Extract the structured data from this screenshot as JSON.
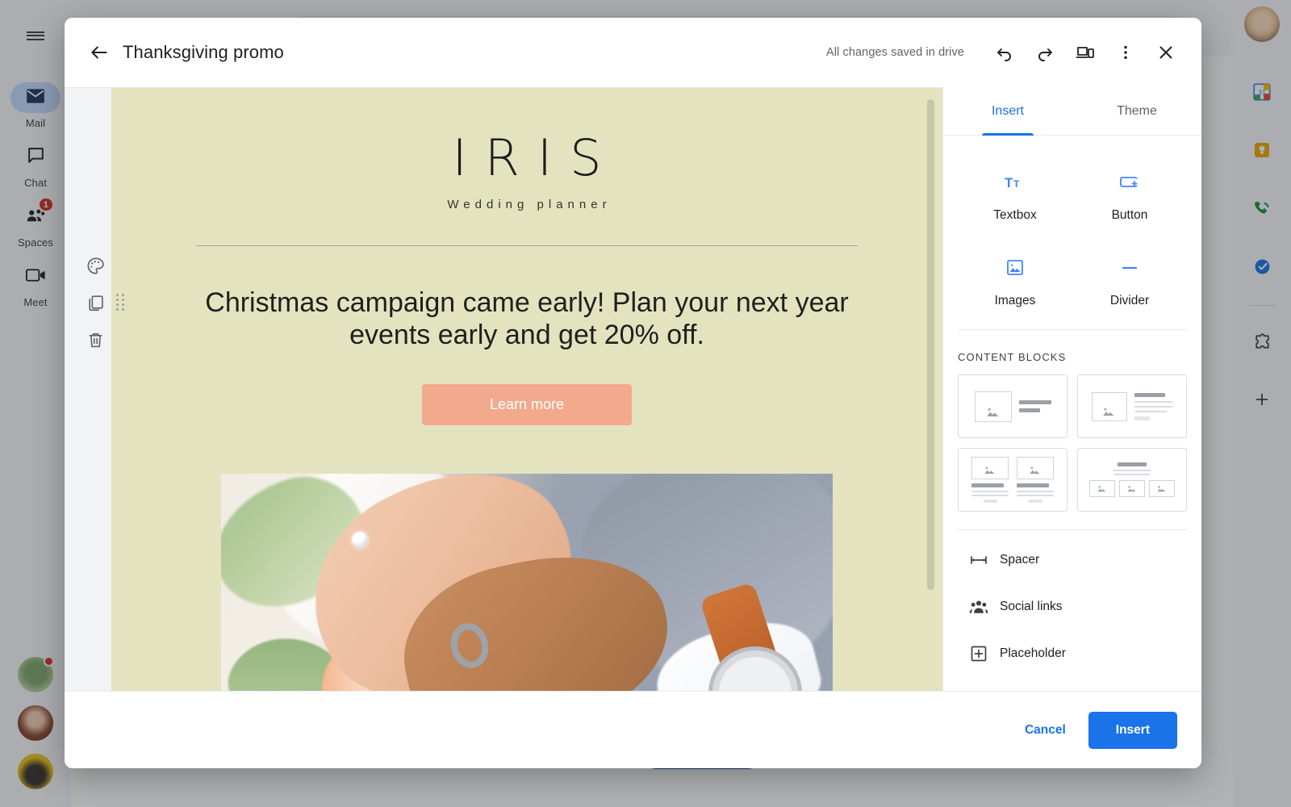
{
  "app": {
    "left_rail": {
      "menu_icon": "hamburger-menu-icon",
      "items": [
        {
          "label": "Mail",
          "icon": "mail-icon",
          "active": true,
          "badge": ""
        },
        {
          "label": "Chat",
          "icon": "chat-bubble-icon",
          "active": false,
          "badge": ""
        },
        {
          "label": "Spaces",
          "icon": "spaces-people-icon",
          "active": false,
          "badge": "1"
        },
        {
          "label": "Meet",
          "icon": "video-camera-icon",
          "active": false,
          "badge": ""
        }
      ]
    },
    "right_rail": {
      "icons": [
        "calendar-icon",
        "keep-notes-icon",
        "voice-phone-icon",
        "tasks-icon",
        "addons-puzzle-icon",
        "add-plus-icon"
      ]
    }
  },
  "modal": {
    "header": {
      "back_icon": "arrow-back-icon",
      "title": "Thanksgiving promo",
      "save_status": "All changes saved in drive",
      "undo_icon": "undo-icon",
      "redo_icon": "redo-icon",
      "preview_icon": "device-preview-icon",
      "more_icon": "more-vertical-icon",
      "close_icon": "close-icon"
    },
    "canvas": {
      "tools": [
        "palette-icon",
        "duplicate-icon",
        "trash-icon"
      ],
      "drag_handle": "drag-handle-icon",
      "background_color": "#e4e3bf",
      "email": {
        "brand_name": "IRIS",
        "brand_subtitle": "Wedding planner",
        "headline": "Christmas campaign came early! Plan your next year events early and get 20% off.",
        "cta_label": "Learn more",
        "cta_color": "#f2a98c",
        "hero_image": "wedding-hands-rings-photo"
      }
    },
    "panel": {
      "tabs": [
        {
          "label": "Insert",
          "active": true
        },
        {
          "label": "Theme",
          "active": false
        }
      ],
      "insert_items": [
        {
          "label": "Textbox",
          "icon": "textbox-icon"
        },
        {
          "label": "Button",
          "icon": "button-add-icon"
        },
        {
          "label": "Images",
          "icon": "image-icon"
        },
        {
          "label": "Divider",
          "icon": "divider-icon"
        }
      ],
      "content_blocks_title": "CONTENT BLOCKS",
      "content_blocks": [
        {
          "name": "image-left-short-text-block"
        },
        {
          "name": "image-left-paragraph-block"
        },
        {
          "name": "two-column-image-text-block"
        },
        {
          "name": "heading-three-images-block"
        }
      ],
      "list_items": [
        {
          "label": "Spacer",
          "icon": "spacer-icon"
        },
        {
          "label": "Social links",
          "icon": "social-links-people-icon"
        },
        {
          "label": "Placeholder",
          "icon": "placeholder-plus-icon"
        }
      ]
    },
    "footer": {
      "cancel_label": "Cancel",
      "insert_label": "Insert",
      "accent_color": "#1a73e8"
    }
  }
}
